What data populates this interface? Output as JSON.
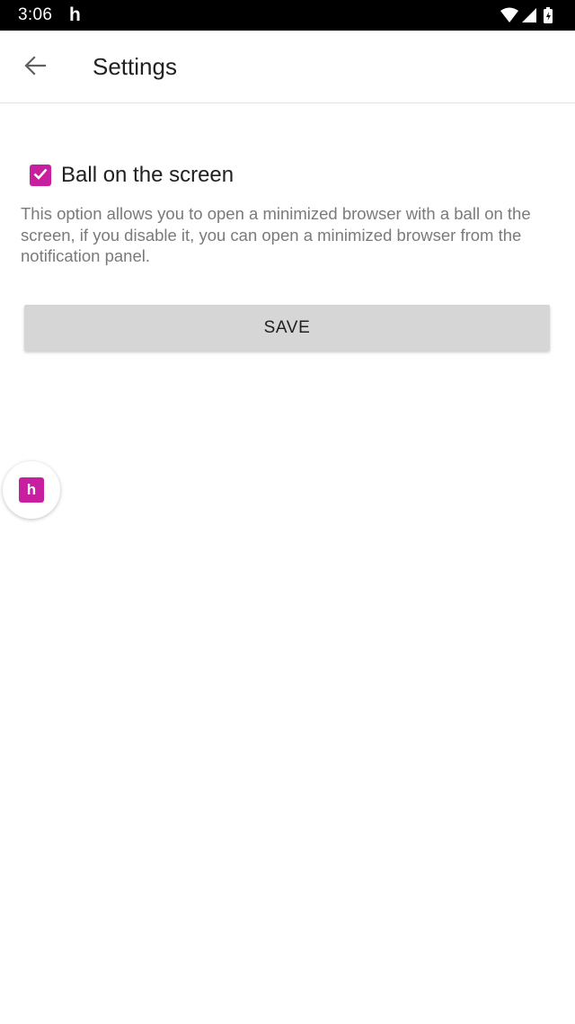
{
  "status_bar": {
    "time": "3:06",
    "app_icon_glyph": "h",
    "icons": [
      "wifi-icon",
      "signal-icon",
      "battery-icon"
    ]
  },
  "app_bar": {
    "back_icon": "arrow-back-icon",
    "title": "Settings"
  },
  "settings": {
    "ball_option": {
      "label": "Ball on the screen",
      "checked": true,
      "description": "This option allows you to open a minimized browser with a ball on the screen, if you disable it, you can open a minimized browser from the notification panel."
    },
    "save_label": "SAVE"
  },
  "floating_ball": {
    "logo_glyph": "h"
  },
  "colors": {
    "accent": "#c81fa0",
    "status_bar": "#000000",
    "button_bg": "#d6d6d6",
    "description_text": "#7a7a7a"
  }
}
